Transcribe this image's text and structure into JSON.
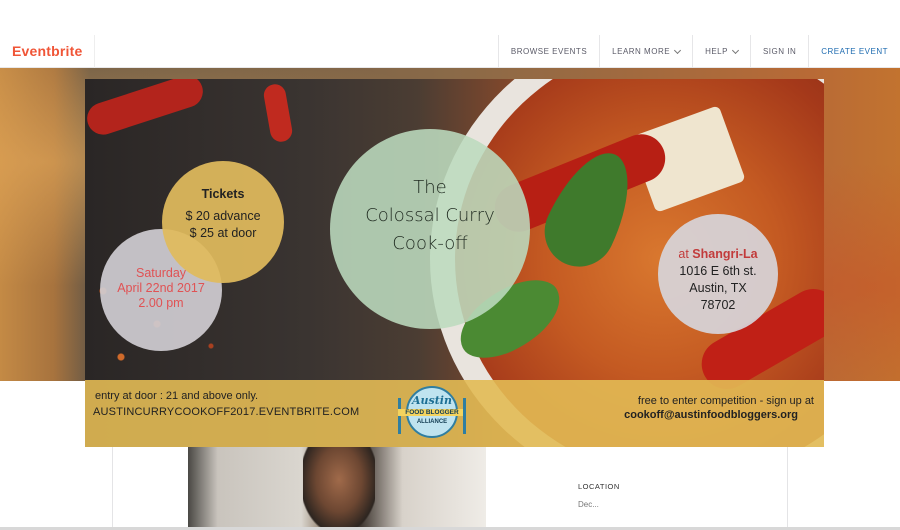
{
  "header": {
    "logo": "Eventbrite",
    "nav": [
      {
        "label": "BROWSE EVENTS",
        "dropdown": false
      },
      {
        "label": "LEARN MORE",
        "dropdown": true
      },
      {
        "label": "HELP",
        "dropdown": true
      },
      {
        "label": "SIGN IN",
        "dropdown": false
      },
      {
        "label": "CREATE EVENT",
        "dropdown": false
      }
    ]
  },
  "banner": {
    "date": [
      "Saturday",
      "April 22nd 2017",
      "2.00 pm"
    ],
    "tickets": {
      "heading": "Tickets",
      "lines": [
        "$ 20 advance",
        "$ 25 at door"
      ]
    },
    "title": [
      "The",
      "Colossal Curry",
      "Cook-off"
    ],
    "venue": {
      "at": "at ",
      "name": "Shangri-La",
      "lines": [
        "1016 E 6th st.",
        "Austin, TX",
        "78702"
      ]
    },
    "strip": {
      "entry": "entry at door  :   21 and above only.",
      "site": "AUSTINCURRYCOOKOFF2017.EVENTBRITE.COM",
      "signup": "free to enter competition - sign up at",
      "email": "cookoff@austinfoodbloggers.org"
    },
    "badge": {
      "line1": "Austin",
      "line2": "FOOD BLOGGER",
      "line3": "ALLIANCE"
    }
  },
  "details": {
    "location_label": "LOCATION",
    "location_value": "Dec..."
  },
  "colors": {
    "brand": "#f05537",
    "link": "#1e6bb0",
    "strip": "#e2ba54"
  }
}
